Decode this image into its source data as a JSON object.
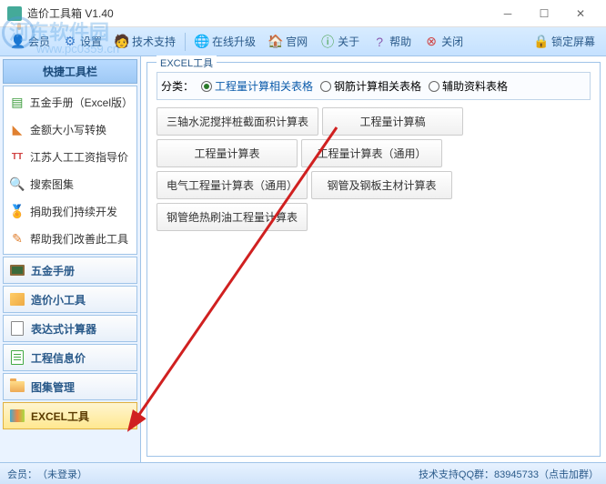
{
  "window": {
    "title": "造价工具箱 V1.40"
  },
  "watermark": {
    "text": "河东软件园",
    "url": "www.pc0359.cn"
  },
  "toolbar": {
    "member": "会员",
    "settings": "设置",
    "support": "技术支持",
    "upgrade": "在线升级",
    "website": "官网",
    "about": "关于",
    "help": "帮助",
    "close": "关闭",
    "lock": "锁定屏幕"
  },
  "sidebar": {
    "header": "快捷工具栏",
    "quickItems": [
      {
        "label": "五金手册（Excel版）"
      },
      {
        "label": "金额大小写转换"
      },
      {
        "label": "江苏人工工资指导价"
      },
      {
        "label": "搜索图集"
      },
      {
        "label": "捐助我们持续开发"
      },
      {
        "label": "帮助我们改善此工具"
      }
    ],
    "navItems": [
      {
        "label": "五金手册"
      },
      {
        "label": "造价小工具"
      },
      {
        "label": "表达式计算器"
      },
      {
        "label": "工程信息价"
      },
      {
        "label": "图集管理"
      },
      {
        "label": "EXCEL工具",
        "active": true
      }
    ]
  },
  "content": {
    "panelTitle": "EXCEL工具",
    "filterLabel": "分类：",
    "filters": [
      {
        "label": "工程量计算相关表格",
        "checked": true
      },
      {
        "label": "钢筋计算相关表格",
        "checked": false
      },
      {
        "label": "辅助资料表格",
        "checked": false
      }
    ],
    "tools": [
      "三轴水泥搅拌桩截面积计算表",
      "工程量计算稿",
      "工程量计算表",
      "工程量计算表（通用）",
      "电气工程量计算表（通用）",
      "钢管及钢板主材计算表",
      "钢管绝热刷油工程量计算表"
    ]
  },
  "statusbar": {
    "memberLabel": "会员：",
    "memberStatus": "（未登录）",
    "support": "技术支持QQ群：83945733（点击加群）"
  }
}
